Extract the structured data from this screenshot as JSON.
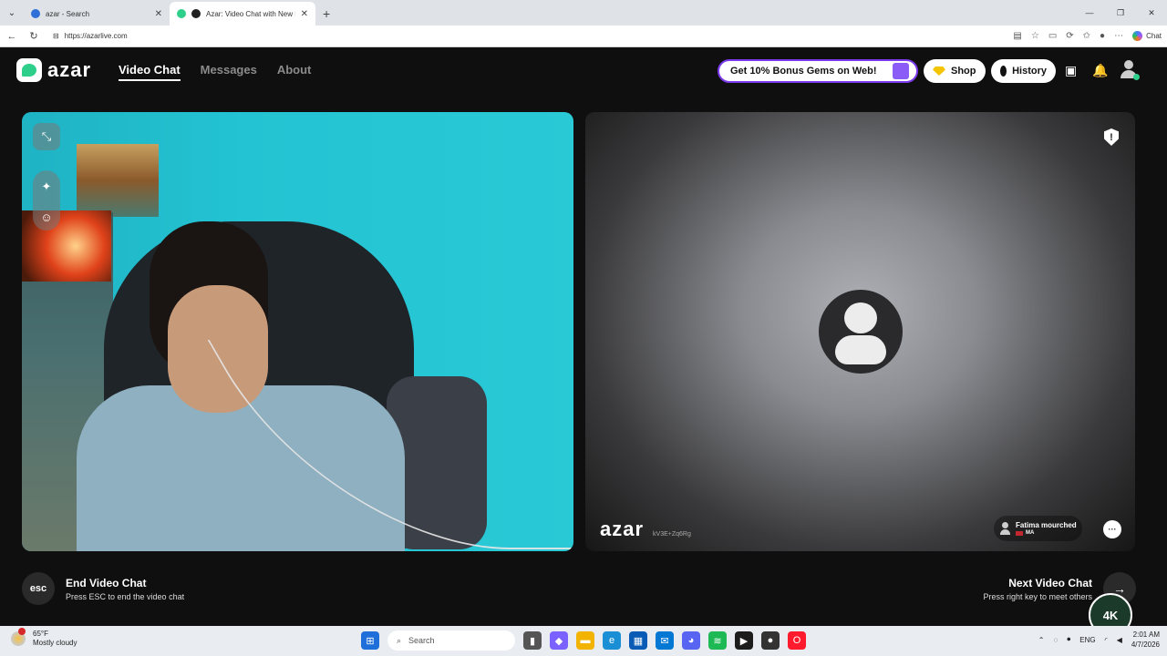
{
  "browser": {
    "tabs": [
      {
        "title": "azar - Search",
        "active": false
      },
      {
        "title": "Azar: Video Chat with New Fr",
        "active": true
      }
    ],
    "url": "https://azarlive.com",
    "chat_label": "Chat"
  },
  "app": {
    "logo_text": "azar",
    "nav": [
      {
        "label": "Video Chat",
        "active": true
      },
      {
        "label": "Messages",
        "active": false
      },
      {
        "label": "About",
        "active": false
      }
    ],
    "promo_label": "Get 10% Bonus Gems on Web!",
    "shop_label": "Shop",
    "history_label": "History",
    "accent": "#7c3aed",
    "online_color": "#2ecf8a"
  },
  "remote": {
    "watermark": "azar",
    "watermark_id": "kV3E+Zq6Rg",
    "partner_name": "Fatima mourched",
    "partner_country": "MA"
  },
  "footer": {
    "esc_key": "esc",
    "end_title": "End Video Chat",
    "end_sub": "Press ESC to end the video chat",
    "next_title": "Next Video Chat",
    "next_sub": "Press right key to meet others",
    "badge": "4K"
  },
  "taskbar": {
    "temp": "65°F",
    "weather": "Mostly cloudy",
    "search_placeholder": "Search",
    "lang": "ENG",
    "time": "2:01 AM",
    "date": "4/7/2026"
  }
}
